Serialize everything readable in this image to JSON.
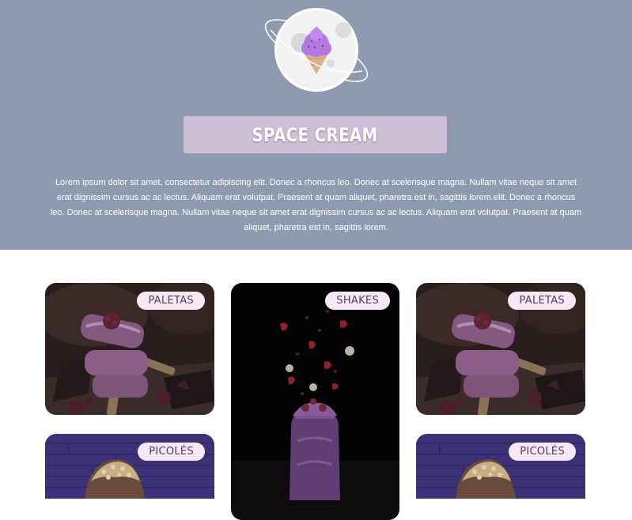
{
  "hero": {
    "logo_icon": "ice-cream-planet-icon",
    "title": "SPACE CREAM",
    "description": "Lorem ipsum dolor sit amet, consectetur adipiscing elit. Donec a rhoncus leo. Donec at scelerisque magna. Nullam vitae neque sit amet erat dignissim cursus ac ac lectus. Aliquam erat volutpat. Praesent at quam aliquet, pharetra est in, sagittis lorem.elit. Donec a rhoncus leo. Donec at scelerisque magna. Nullam vitae neque sit amet erat dignissim cursus ac ac lectus. Aliquam erat volutpat. Praesent at quam aliquet, pharetra est in, sagittis lorem."
  },
  "products": [
    {
      "badge": "PALETAS",
      "image": "popsicle-photo"
    },
    {
      "badge": "SHAKES",
      "image": "shake-photo"
    },
    {
      "badge": "PALETAS",
      "image": "popsicle-photo"
    },
    {
      "badge": "PICOLÉS",
      "image": "ice-cream-bar-photo"
    },
    {
      "badge": "PICOLÉS",
      "image": "ice-cream-bar-photo"
    }
  ],
  "colors": {
    "hero_background": "#8e9ab0",
    "title_box": "#cdbfd6",
    "badge_background": "#f8e8f6",
    "badge_text": "#4d3f5e"
  }
}
